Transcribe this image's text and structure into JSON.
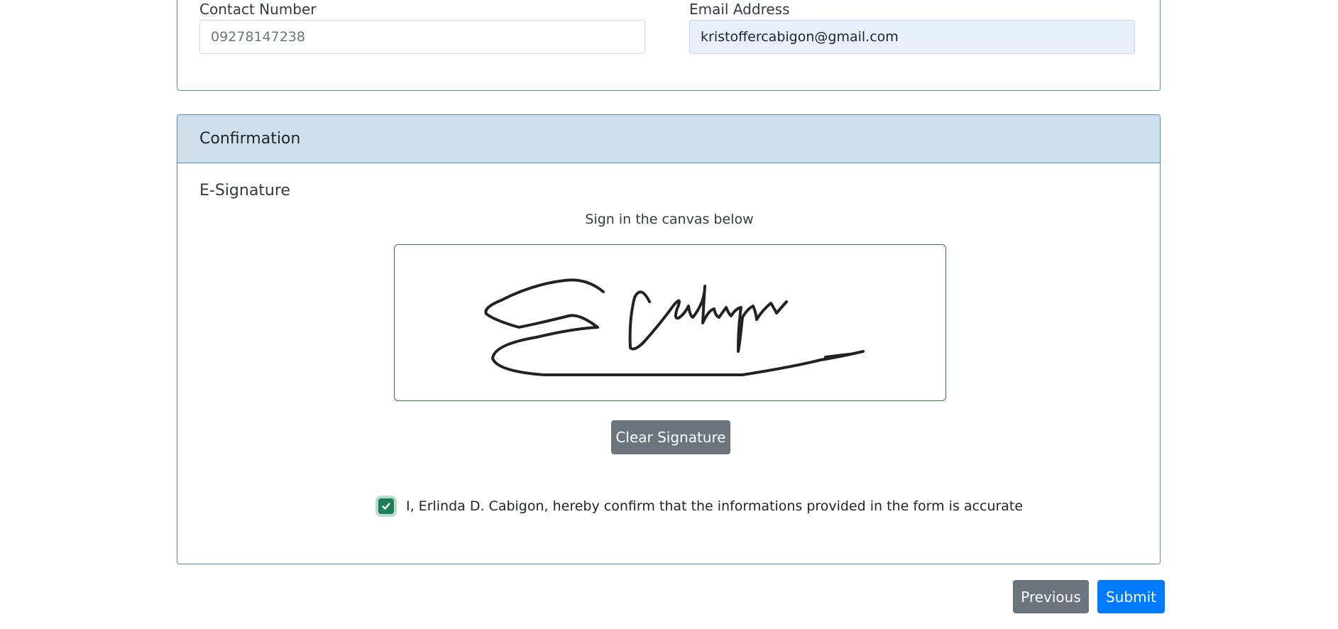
{
  "contact": {
    "label": "Contact Number",
    "value": "09278147238"
  },
  "email": {
    "label": "Email Address",
    "value": "kristoffercabigon@gmail.com"
  },
  "confirmation": {
    "header": "Confirmation",
    "esignature_title": "E-Signature",
    "sign_hint": "Sign in the canvas below",
    "clear_label": "Clear Signature",
    "confirm_checked": true,
    "confirm_text": "I, Erlinda D. Cabigon, hereby confirm that the informations provided in the form is accurate"
  },
  "nav": {
    "previous_label": "Previous",
    "submit_label": "Submit"
  },
  "colors": {
    "primary": "#007bff",
    "secondary": "#6c757d",
    "card_header": "#cfe0ec",
    "checkbox": "#1e7e5a",
    "canvas_border": "#2e7d32"
  },
  "icons": {
    "checkbox": "check-icon"
  }
}
